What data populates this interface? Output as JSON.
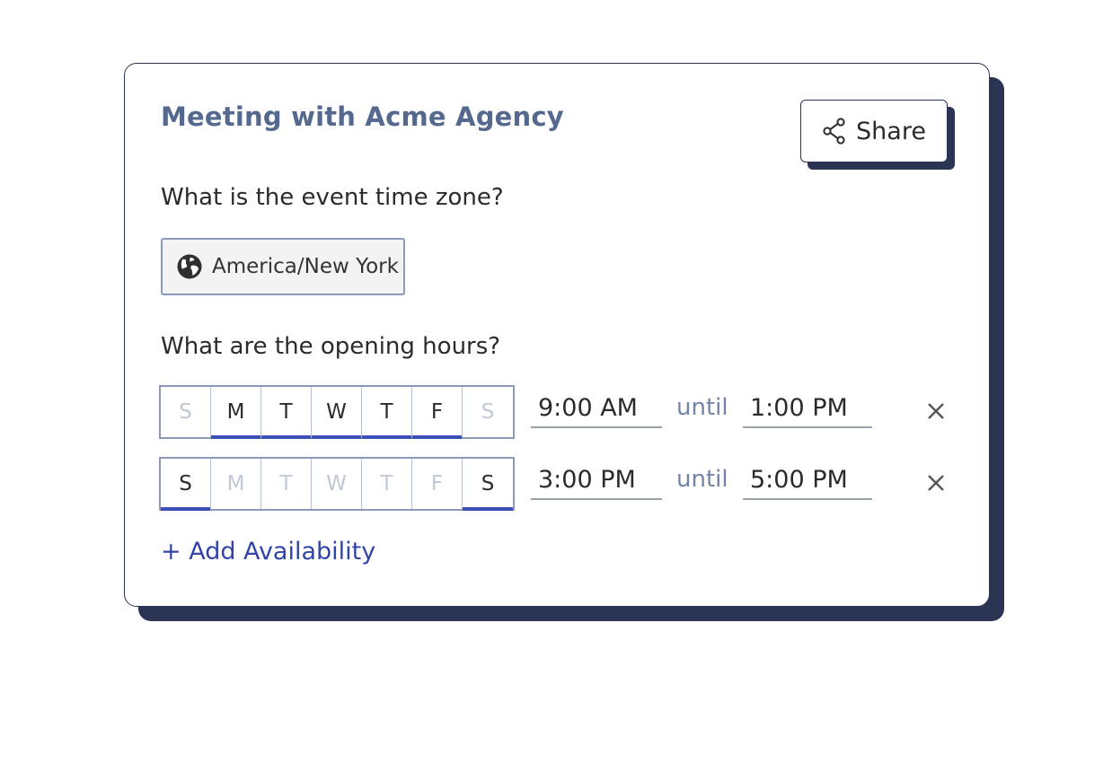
{
  "title": "Meeting with Acme Agency",
  "share": {
    "label": "Share",
    "icon": "share-icon"
  },
  "timezone": {
    "question": "What is the event time zone?",
    "value": "America/New York",
    "icon": "globe-icon"
  },
  "hours": {
    "question": "What are the opening hours?",
    "until_label": "until",
    "rows": [
      {
        "days": [
          {
            "label": "S",
            "selected": false
          },
          {
            "label": "M",
            "selected": true
          },
          {
            "label": "T",
            "selected": true
          },
          {
            "label": "W",
            "selected": true
          },
          {
            "label": "T",
            "selected": true
          },
          {
            "label": "F",
            "selected": true
          },
          {
            "label": "S",
            "selected": false
          }
        ],
        "from": "9:00 AM",
        "to": "1:00 PM"
      },
      {
        "days": [
          {
            "label": "S",
            "selected": true
          },
          {
            "label": "M",
            "selected": false
          },
          {
            "label": "T",
            "selected": false
          },
          {
            "label": "W",
            "selected": false
          },
          {
            "label": "T",
            "selected": false
          },
          {
            "label": "F",
            "selected": false
          },
          {
            "label": "S",
            "selected": true
          }
        ],
        "from": "3:00 PM",
        "to": "5:00 PM"
      }
    ],
    "add_label": "+ Add Availability"
  },
  "colors": {
    "accent": "#3a4fb8",
    "title": "#55688e",
    "shadow": "#2b3553",
    "muted_day": "#c0c8d6"
  }
}
